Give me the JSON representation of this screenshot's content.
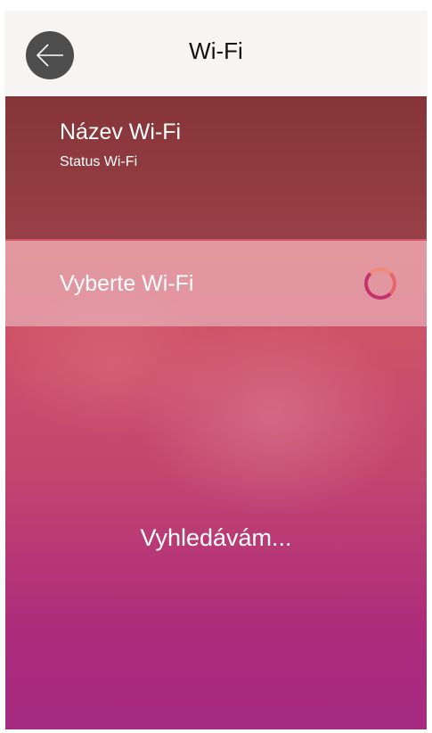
{
  "header": {
    "title": "Wi-Fi"
  },
  "info": {
    "wifi_name": "Název Wi-Fi",
    "wifi_status": "Status Wi-Fi"
  },
  "select": {
    "label": "Vyberte Wi-Fi"
  },
  "main": {
    "searching_text": "Vyhledávám..."
  },
  "icons": {
    "back": "arrow-left-icon",
    "spinner": "loading-spinner-icon"
  },
  "colors": {
    "header_bg": "#f7f5f4",
    "back_button_bg": "#4e4d4d",
    "gradient_top": "#d9605d",
    "gradient_bottom": "#a52a80",
    "spinner": "#c4326f"
  }
}
